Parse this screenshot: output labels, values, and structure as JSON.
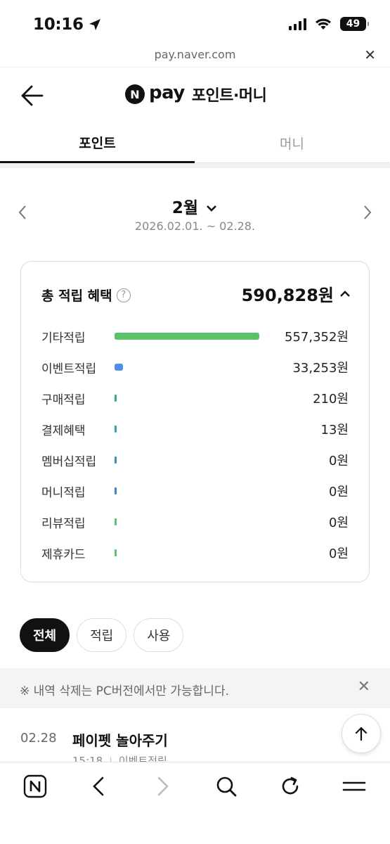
{
  "status_bar": {
    "time": "10:16",
    "battery": "49",
    "battery_level": 0.49
  },
  "browser": {
    "url": "pay.naver.com"
  },
  "header": {
    "logo_letter": "N",
    "brand_word": "pay",
    "title": "포인트·머니"
  },
  "tabs": [
    {
      "label": "포인트",
      "active": true
    },
    {
      "label": "머니",
      "active": false
    }
  ],
  "month_nav": {
    "month": "2월",
    "period": "2026.02.01. ~ 02.28."
  },
  "benefits": {
    "title": "총 적립 혜택",
    "total": "590,828원",
    "rows": [
      {
        "label": "기타적립",
        "value": "557,352원",
        "amount": 557352,
        "fraction": 1.0,
        "color": "#5ac26a"
      },
      {
        "label": "이벤트적립",
        "value": "33,253원",
        "amount": 33253,
        "fraction": 0.06,
        "color": "#4d8ee8"
      },
      {
        "label": "구매적립",
        "value": "210원",
        "amount": 210,
        "fraction": 0.0,
        "color": "#3aa98f"
      },
      {
        "label": "결제혜택",
        "value": "13원",
        "amount": 13,
        "fraction": 0.0,
        "color": "#3a9fb5"
      },
      {
        "label": "멤버십적립",
        "value": "0원",
        "amount": 0,
        "fraction": 0.0,
        "color": "#3a8fbf"
      },
      {
        "label": "머니적립",
        "value": "0원",
        "amount": 0,
        "fraction": 0.0,
        "color": "#4a7fd6"
      },
      {
        "label": "리뷰적립",
        "value": "0원",
        "amount": 0,
        "fraction": 0.0,
        "color": "#5ac26a"
      },
      {
        "label": "제휴카드",
        "value": "0원",
        "amount": 0,
        "fraction": 0.0,
        "color": "#5ac26a"
      }
    ]
  },
  "filters": [
    {
      "label": "전체",
      "active": true
    },
    {
      "label": "적립",
      "active": false
    },
    {
      "label": "사용",
      "active": false
    }
  ],
  "notice": {
    "text": "※ 내역 삭제는 PC버전에서만 가능합니다."
  },
  "history": [
    {
      "date": "02.28",
      "title": "페이펫 놀아주기",
      "time": "15:18",
      "sep": "|",
      "category": "이벤트적립",
      "amount": "+"
    }
  ],
  "icons": {
    "back": "arrow-left-icon",
    "close": "close-icon",
    "chevron_down": "chevron-down-icon",
    "chevron_up": "chevron-up-icon",
    "help": "question-icon",
    "scroll_top": "arrow-up-icon"
  }
}
